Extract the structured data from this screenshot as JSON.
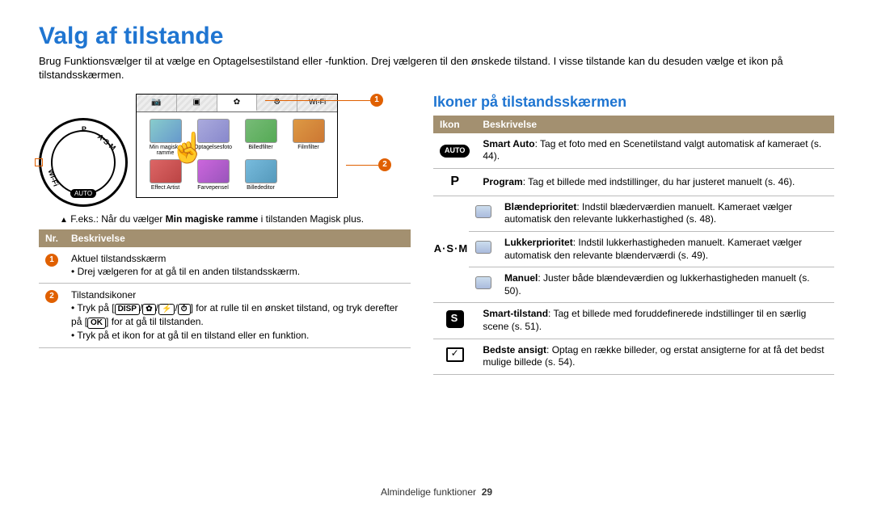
{
  "title": "Valg af tilstande",
  "intro": "Brug Funktionsvælger til at vælge en Optagelsestilstand eller -funktion. Drej vælgeren til den ønskede tilstand. I visse tilstande kan du desuden vælge et ikon på tilstandsskærmen.",
  "example_label": "F.eks.: Når du vælger ",
  "example_bold": "Min magiske ramme",
  "example_tail": " i tilstanden Magisk plus.",
  "dial": {
    "auto": "AUTO",
    "p": "P",
    "asm": "A·S·M",
    "wifi": "Wi-Fi"
  },
  "screen": {
    "tabs": [
      "📷",
      "▣",
      "✿",
      "⚙",
      "Wi-Fi"
    ],
    "apps": [
      "Min magiske ramme",
      "Optagelsesfoto",
      "Billedfilter",
      "Filmfilter",
      "Effect Artist",
      "Farvepensel",
      "Billededitor"
    ]
  },
  "left_table": {
    "headers": [
      "Nr.",
      "Beskrivelse"
    ],
    "rows": [
      {
        "num": "1",
        "heading": "Aktuel tilstandsskærm",
        "bullets": [
          "Drej vælgeren for at gå til en anden tilstandsskærm."
        ]
      },
      {
        "num": "2",
        "heading": "Tilstandsikoner",
        "bullets": [
          {
            "pre": "Tryk på [",
            "btns": [
              "DISP",
              "✿",
              "⚡",
              "⏱"
            ],
            "mid": "] for at rulle til en ønsket tilstand, og tryk derefter på [",
            "btn2": "OK",
            "post": "] for at gå til tilstanden."
          },
          "Tryk på et ikon for at gå til en tilstand eller en funktion."
        ]
      }
    ]
  },
  "right_heading": "Ikoner på tilstandsskærmen",
  "right_table": {
    "headers": [
      "Ikon",
      "Beskrivelse"
    ],
    "rows": [
      {
        "icon": "auto",
        "label": "AUTO",
        "text": "Smart Auto: Tag et foto med en Scenetilstand valgt automatisk af kameraet (s. 44).",
        "bold": "Smart Auto"
      },
      {
        "icon": "p",
        "label": "P",
        "text": "Program: Tag et billede med indstillinger, du har justeret manuelt (s. 46).",
        "bold": "Program"
      }
    ],
    "asm_label": "A·S·M",
    "asm_rows": [
      {
        "bold": "Blændeprioritet",
        "text": ": Indstil blæderværdien manuelt. Kameraet vælger automatisk den relevante lukkerhastighed (s. 48)."
      },
      {
        "bold": "Lukkerprioritet",
        "text": ": Indstil lukkerhastigheden manuelt. Kameraet vælger automatisk den relevante blænderværdi (s. 49)."
      },
      {
        "bold": "Manuel",
        "text": ": Juster både blændeværdien og lukkerhastigheden manuelt (s. 50)."
      }
    ],
    "rows_after": [
      {
        "icon": "s",
        "bold": "Smart-tilstand",
        "text": ": Tag et billede med foruddefinerede indstillinger til en særlig scene (s. 51)."
      },
      {
        "icon": "face",
        "bold": "Bedste ansigt",
        "text": ": Optag en række billeder, og erstat ansigterne for at få det bedst mulige billede (s. 54)."
      }
    ]
  },
  "footer": {
    "section": "Almindelige funktioner",
    "page": "29"
  }
}
